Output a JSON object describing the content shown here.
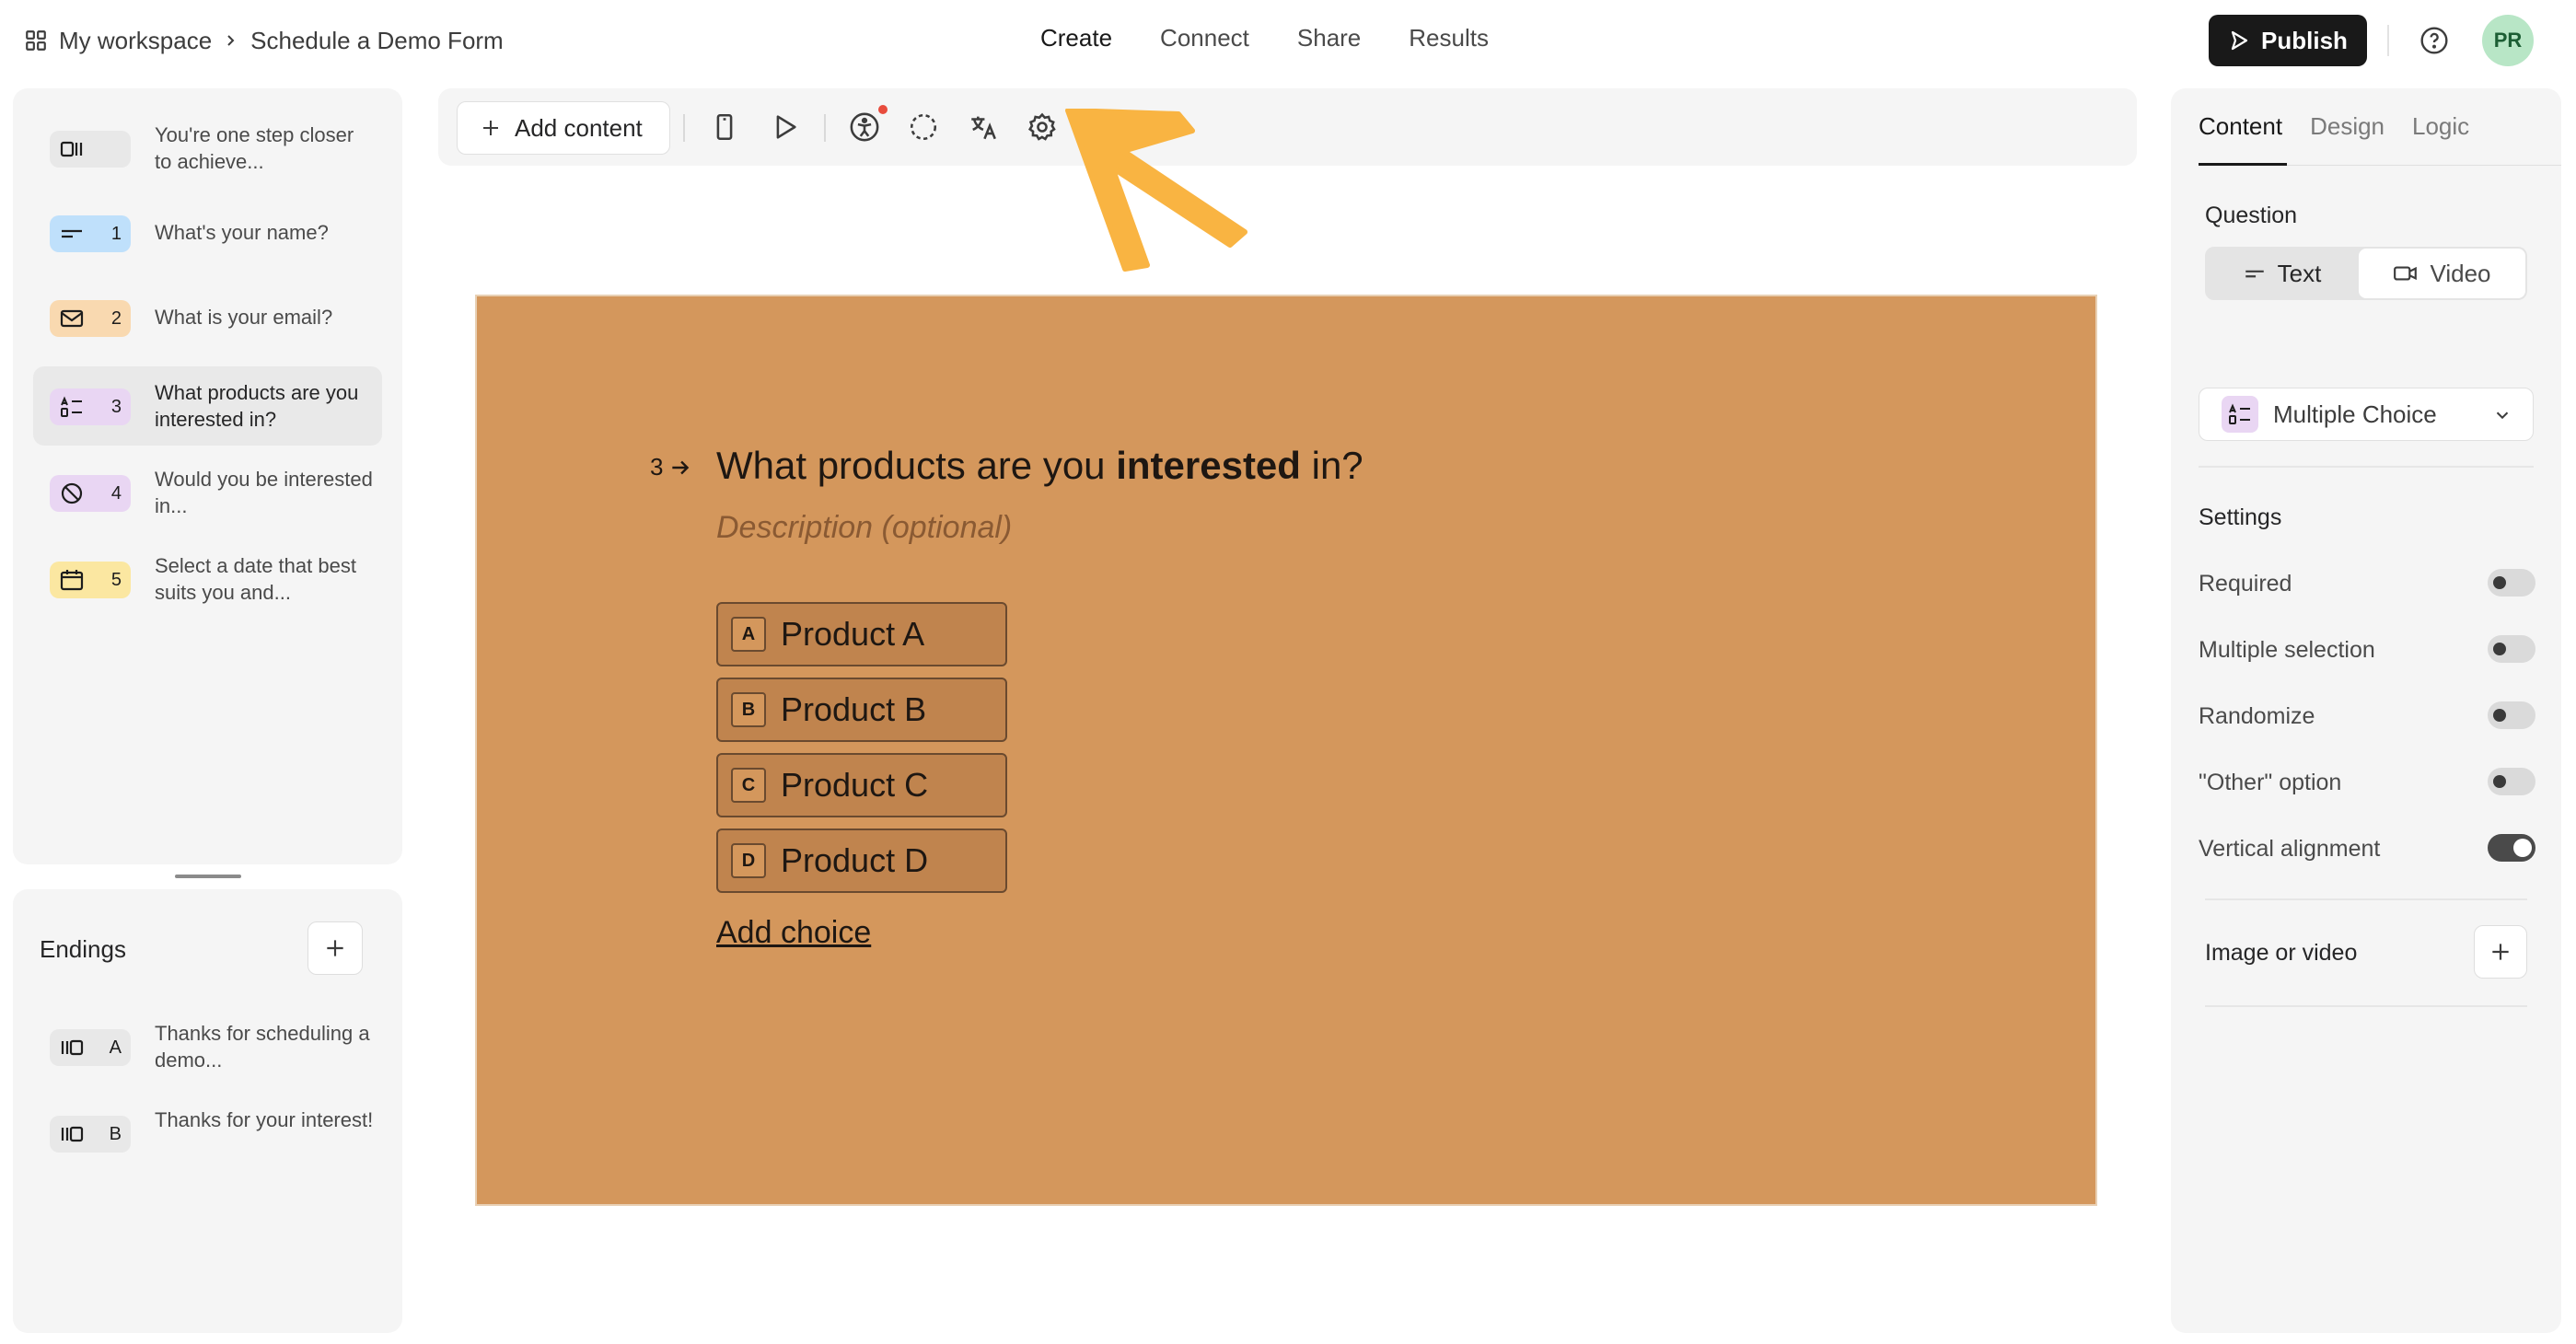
{
  "breadcrumb": {
    "workspace": "My workspace",
    "form": "Schedule a Demo Form"
  },
  "nav": {
    "create": "Create",
    "connect": "Connect",
    "share": "Share",
    "results": "Results"
  },
  "header": {
    "publish_label": "Publish",
    "avatar_initials": "PR"
  },
  "questions": [
    {
      "text": "You're one step closer to achieve...",
      "number": "",
      "icon": "welcome-screen-icon",
      "color": "#e8e8e8"
    },
    {
      "text": "What's your name?",
      "number": "1",
      "icon": "short-text-icon",
      "color": "#bfe0fb"
    },
    {
      "text": "What is your email?",
      "number": "2",
      "icon": "envelope-icon",
      "color": "#f9d9b0"
    },
    {
      "text": "What products are you interested in?",
      "number": "3",
      "icon": "multiple-choice-icon",
      "color": "#e9d6f3"
    },
    {
      "text": "Would you be interested in...",
      "number": "4",
      "icon": "no-symbol-icon",
      "color": "#e9d6f3"
    },
    {
      "text": "Select a date that best suits you and...",
      "number": "5",
      "icon": "calendar-icon",
      "color": "#fbe7a1"
    }
  ],
  "endings": {
    "title": "Endings",
    "items": [
      {
        "key": "A",
        "text": "Thanks for scheduling a demo..."
      },
      {
        "key": "B",
        "text": "Thanks for your interest!"
      }
    ]
  },
  "toolbar": {
    "add_content_label": "Add content"
  },
  "canvas": {
    "background": "#d4975c",
    "question_number": "3",
    "title_before": "What products are you ",
    "title_bold": "interested",
    "title_after": " in?",
    "description_placeholder": "Description (optional)",
    "choices": [
      {
        "key": "A",
        "label": "Product A"
      },
      {
        "key": "B",
        "label": "Product B"
      },
      {
        "key": "C",
        "label": "Product C"
      },
      {
        "key": "D",
        "label": "Product D"
      }
    ],
    "add_choice_label": "Add choice"
  },
  "right_panel": {
    "tabs": {
      "content": "Content",
      "design": "Design",
      "logic": "Logic"
    },
    "question_label": "Question",
    "question_type_text": "Text",
    "question_type_video": "Video",
    "type_select_value": "Multiple Choice",
    "settings_label": "Settings",
    "settings": [
      {
        "label": "Required",
        "on": false
      },
      {
        "label": "Multiple selection",
        "on": false
      },
      {
        "label": "Randomize",
        "on": false
      },
      {
        "label": "\"Other\" option",
        "on": false
      },
      {
        "label": "Vertical alignment",
        "on": true
      }
    ],
    "image_or_video_label": "Image or video"
  },
  "annotation": {
    "arrow_color": "#f9b442"
  }
}
